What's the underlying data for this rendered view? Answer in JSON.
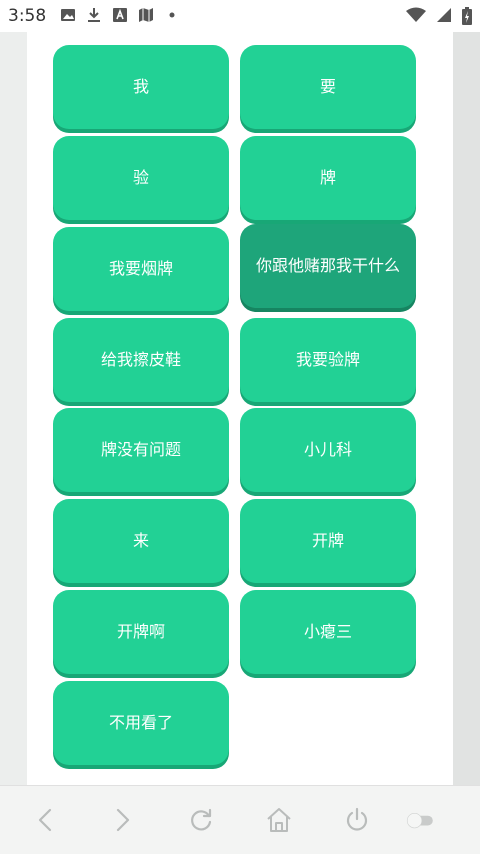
{
  "status_bar": {
    "time": "3:58",
    "left_icons": [
      "image-icon",
      "download-icon",
      "a-box-icon",
      "map-icon",
      "dot-icon"
    ],
    "right_icons": [
      "wifi-icon",
      "signal-icon",
      "battery-charging-icon"
    ]
  },
  "buttons": [
    {
      "label": "我",
      "active": false
    },
    {
      "label": "要",
      "active": false
    },
    {
      "label": "验",
      "active": false
    },
    {
      "label": "牌",
      "active": false
    },
    {
      "label": "我要烟牌",
      "active": false
    },
    {
      "label": "你跟他赌那我干什么",
      "active": true
    },
    {
      "label": "给我擦皮鞋",
      "active": false
    },
    {
      "label": "我要验牌",
      "active": false
    },
    {
      "label": "牌没有问题",
      "active": false
    },
    {
      "label": "小儿科",
      "active": false
    },
    {
      "label": "来",
      "active": false
    },
    {
      "label": "开牌",
      "active": false
    },
    {
      "label": "开牌啊",
      "active": false
    },
    {
      "label": "小瘪三",
      "active": false
    },
    {
      "label": "不用看了",
      "active": false
    }
  ],
  "bottom_nav": {
    "icons": [
      "back-icon",
      "forward-icon",
      "refresh-icon",
      "home-icon",
      "power-icon",
      "toggle-icon"
    ]
  },
  "colors": {
    "button": "#22d195",
    "button_active": "#1ea57a",
    "button_shadow": "#18a776"
  }
}
